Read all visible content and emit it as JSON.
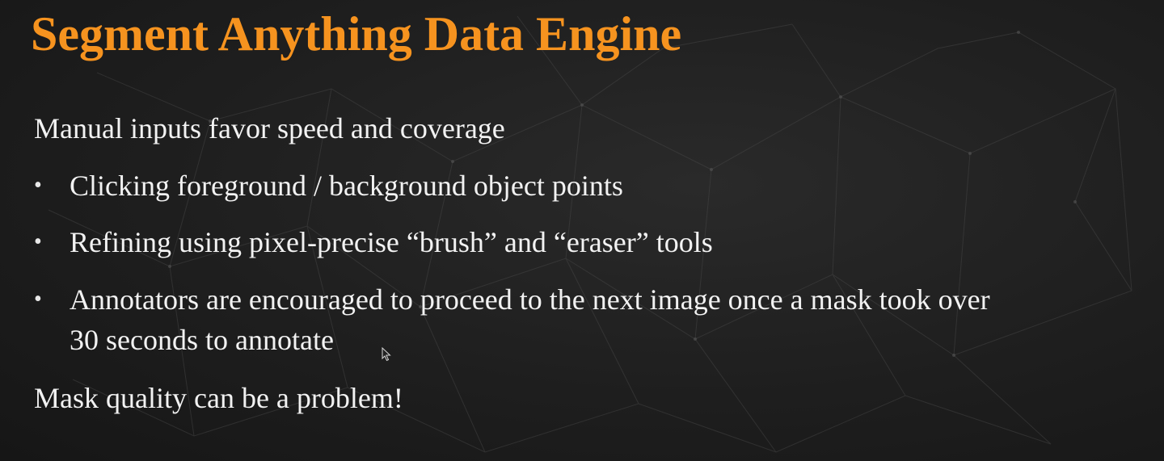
{
  "slide": {
    "title": "Segment Anything Data Engine",
    "intro": "Manual inputs favor speed and coverage",
    "bullets": [
      {
        "line1": "Clicking foreground / background object points"
      },
      {
        "line1": "Refining using pixel-precise “brush” and “eraser” tools"
      },
      {
        "line1": "Annotators are encouraged to proceed to the next image once a mask took over",
        "line2": "30 seconds to annotate"
      }
    ],
    "closing": "Mask quality can be a problem!"
  },
  "colors": {
    "title": "#f6931f",
    "text": "#f2f2f2",
    "background": "#1e1e1e"
  },
  "icons": {
    "bullet": "bullet-dot-icon",
    "cursor": "mouse-pointer-icon"
  }
}
